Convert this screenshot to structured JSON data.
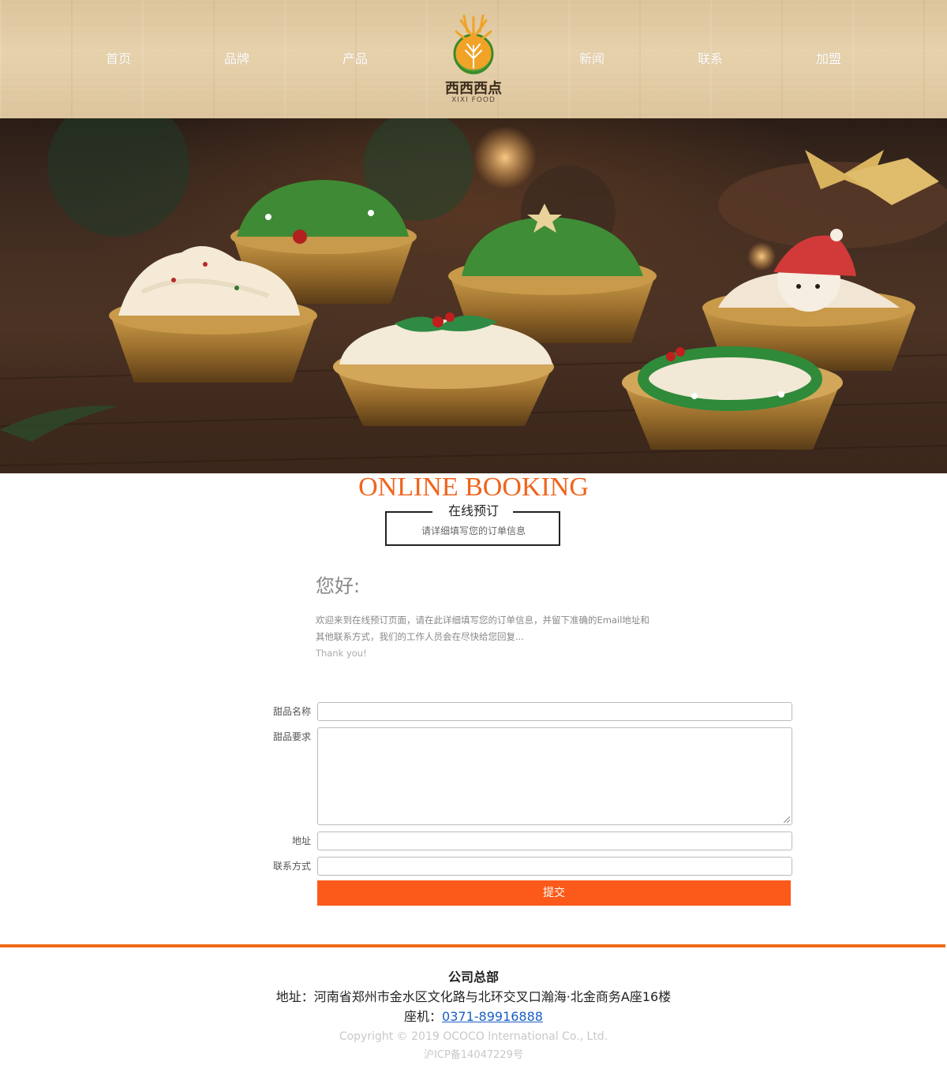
{
  "nav": {
    "items": [
      {
        "label": "首页"
      },
      {
        "label": "品牌"
      },
      {
        "label": "产品"
      },
      {
        "label": "新闻"
      },
      {
        "label": "联系"
      },
      {
        "label": "加盟"
      }
    ]
  },
  "logo": {
    "name_cn": "西西西点",
    "name_en": "XIXI FOOD",
    "icon": "wheat-logo-icon"
  },
  "banner": {
    "image": "christmas-cupcakes-photo"
  },
  "booking": {
    "title_en": "ONLINE BOOKING",
    "title_cn": "在线预订",
    "subtitle": "请详细填写您的订单信息"
  },
  "intro": {
    "greeting": "您好:",
    "text": "欢迎来到在线预订页面，请在此详细填写您的订单信息，并留下准确的Email地址和其他联系方式，我们的工作人员会在尽快给您回复...",
    "thanks": "Thank you!"
  },
  "form": {
    "fields": [
      {
        "label": "甜品名称",
        "value": ""
      },
      {
        "label": "甜品要求",
        "value": ""
      },
      {
        "label": "地址",
        "value": ""
      },
      {
        "label": "联系方式",
        "value": ""
      }
    ],
    "submit_label": "提交"
  },
  "footer": {
    "title": "公司总部",
    "address": "地址：河南省郑州市金水区文化路与北环交叉口瀚海·北金商务A座16楼",
    "phone_label": "座机：",
    "phone": "0371-89916888",
    "copyright": "Copyright © 2019 OCOCO International Co., Ltd.",
    "icp": "沪ICP备14047229号"
  },
  "colors": {
    "accent": "#f0641e",
    "button": "#fc5a1a",
    "footer_line": "#f06a16",
    "link": "#1a5fc4"
  }
}
